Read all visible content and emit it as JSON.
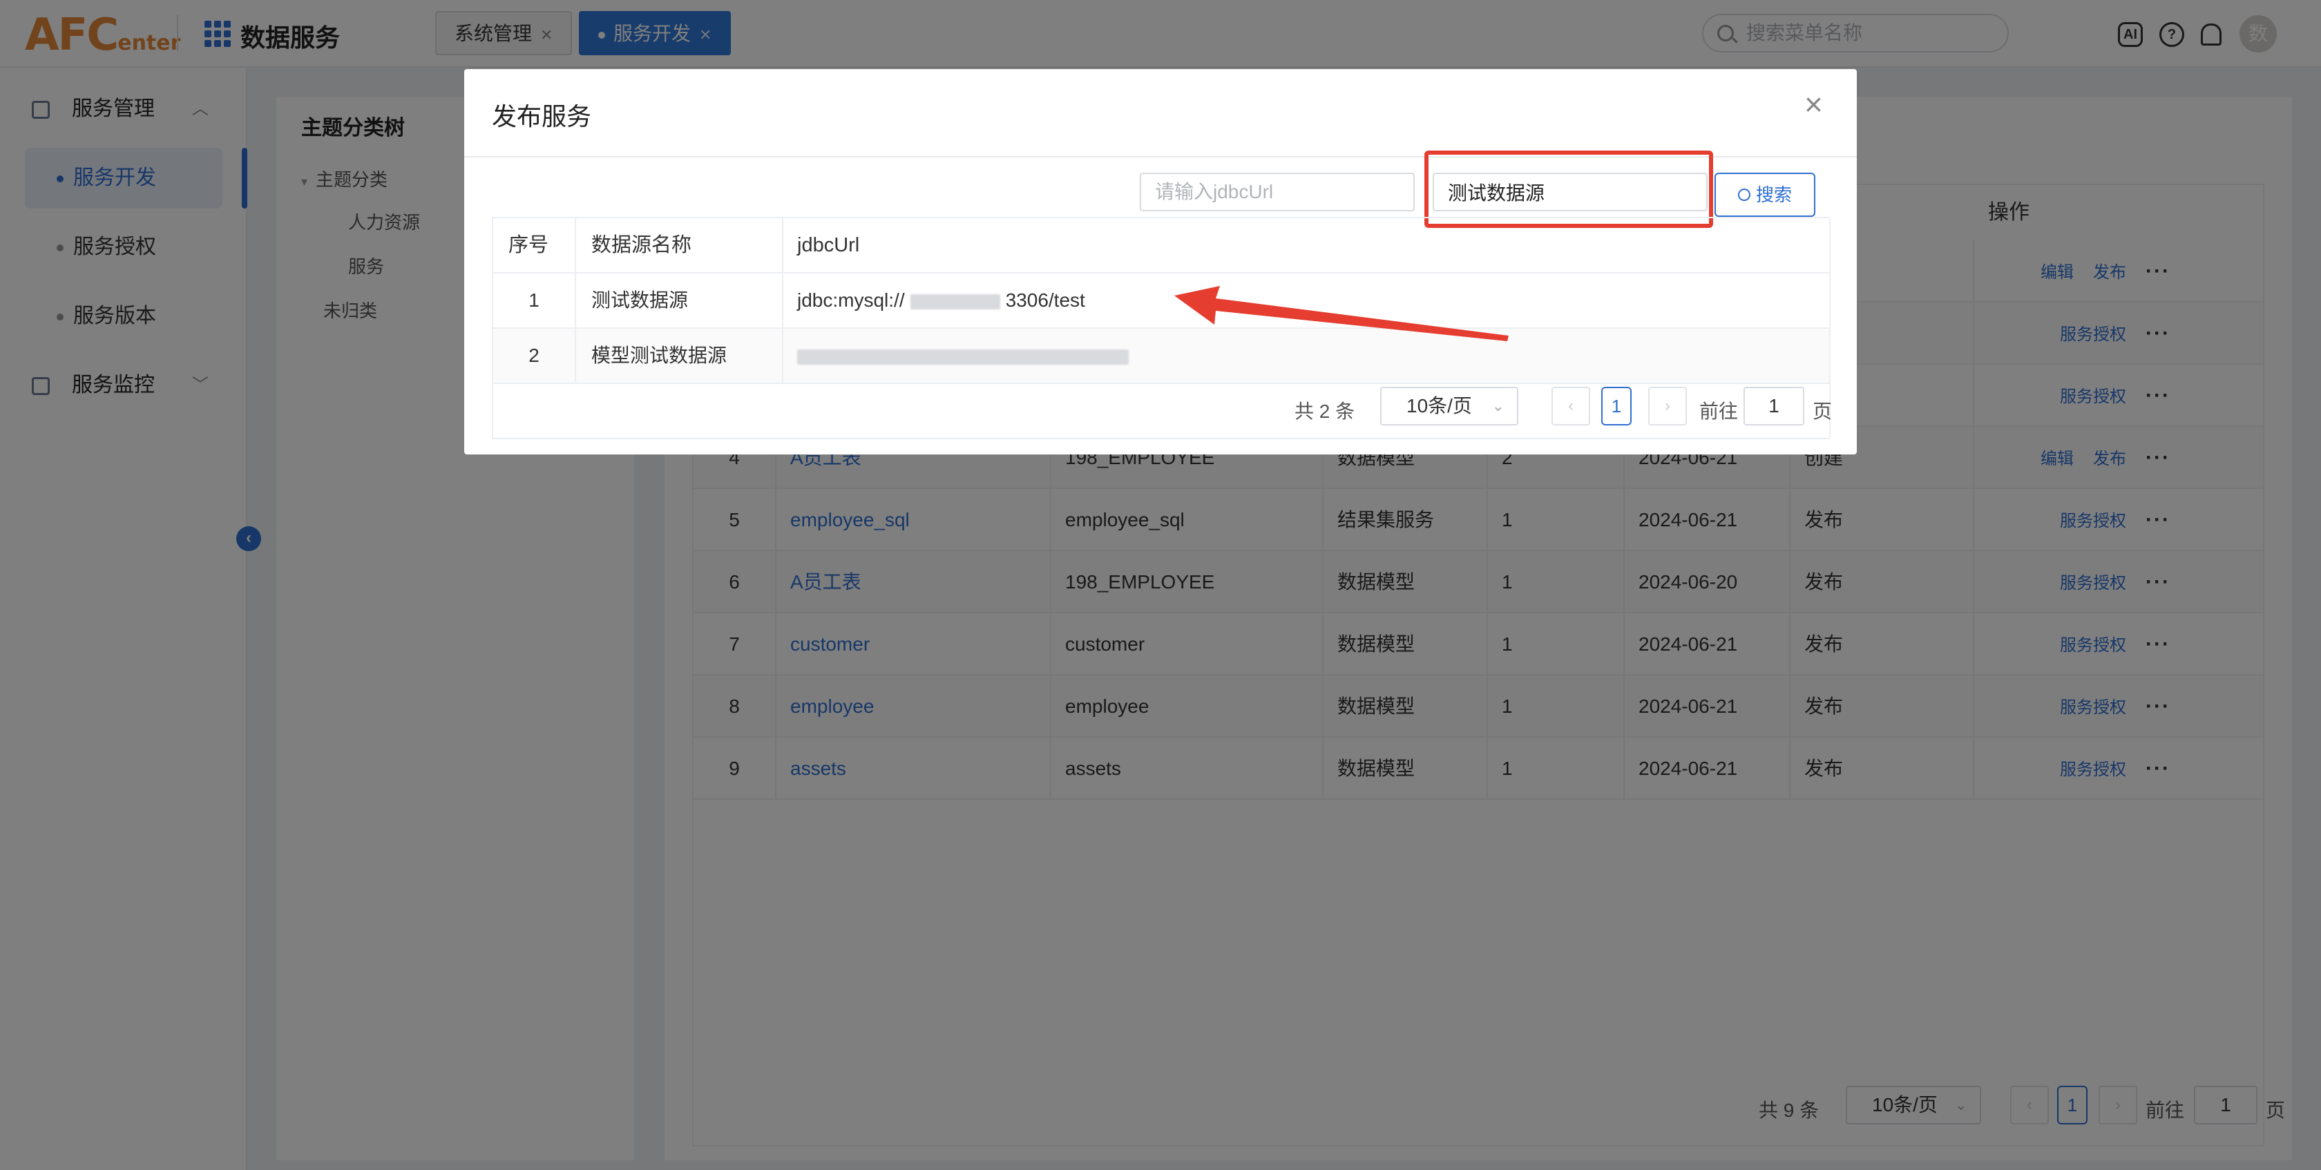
{
  "app": {
    "logo_main": "AFC",
    "logo_sub": "enter",
    "title": "数据服务",
    "tabs": [
      {
        "label": "系统管理"
      },
      {
        "label": "服务开发"
      }
    ],
    "search_placeholder": "搜索菜单名称",
    "ai_label": "AI",
    "help_label": "?",
    "avatar_text": "数"
  },
  "sidebar": {
    "group1": "服务管理",
    "items": [
      {
        "label": "服务开发"
      },
      {
        "label": "服务授权"
      },
      {
        "label": "服务版本"
      }
    ],
    "group2": "服务监控",
    "collapse_glyph": "‹"
  },
  "tree": {
    "title": "主题分类树",
    "root": "主题分类",
    "children": [
      "人力资源",
      "服务"
    ],
    "uncategorized": "未归类"
  },
  "service_table": {
    "ops_header": "操作",
    "rows": [
      {
        "no": "",
        "name": "",
        "table": "",
        "type": "",
        "version": "",
        "date": "",
        "status": "",
        "ops": [
          "编辑",
          "发布"
        ]
      },
      {
        "no": "",
        "name": "",
        "table": "",
        "type": "",
        "version": "",
        "date": "",
        "status": "",
        "ops": [
          "服务授权"
        ]
      },
      {
        "no": "",
        "name": "",
        "table": "",
        "type": "",
        "version": "",
        "date": "",
        "status": "",
        "ops": [
          "服务授权"
        ]
      },
      {
        "no": "4",
        "name": "A员工表",
        "table": "198_EMPLOYEE",
        "type": "数据模型",
        "version": "2",
        "date": "2024-06-21",
        "status": "创建",
        "ops": [
          "编辑",
          "发布"
        ]
      },
      {
        "no": "5",
        "name": "employee_sql",
        "table": "employee_sql",
        "type": "结果集服务",
        "version": "1",
        "date": "2024-06-21",
        "status": "发布",
        "ops": [
          "服务授权"
        ]
      },
      {
        "no": "6",
        "name": "A员工表",
        "table": "198_EMPLOYEE",
        "type": "数据模型",
        "version": "1",
        "date": "2024-06-20",
        "status": "发布",
        "ops": [
          "服务授权"
        ]
      },
      {
        "no": "7",
        "name": "customer",
        "table": "customer",
        "type": "数据模型",
        "version": "1",
        "date": "2024-06-21",
        "status": "发布",
        "ops": [
          "服务授权"
        ]
      },
      {
        "no": "8",
        "name": "employee",
        "table": "employee",
        "type": "数据模型",
        "version": "1",
        "date": "2024-06-21",
        "status": "发布",
        "ops": [
          "服务授权"
        ]
      },
      {
        "no": "9",
        "name": "assets",
        "table": "assets",
        "type": "数据模型",
        "version": "1",
        "date": "2024-06-21",
        "status": "发布",
        "ops": [
          "服务授权"
        ]
      }
    ],
    "more_glyph": "···",
    "pager": {
      "total": "共 9 条",
      "page_size": "10条/页",
      "current_page": "1",
      "goto_label": "前往",
      "goto_value": "1",
      "page_unit": "页"
    }
  },
  "dialog": {
    "title": "发布服务",
    "close_glyph": "×",
    "jdbc_placeholder": "请输入jdbcUrl",
    "name_value": "测试数据源",
    "search_label": "搜索",
    "columns": [
      "序号",
      "数据源名称",
      "jdbcUrl"
    ],
    "rows": [
      {
        "no": "1",
        "name": "测试数据源",
        "url_prefix": "jdbc:mysql://",
        "url_suffix": "3306/test"
      },
      {
        "no": "2",
        "name": "模型测试数据源",
        "url_prefix": "",
        "url_suffix": ""
      }
    ],
    "pager": {
      "total": "共 2 条",
      "page_size": "10条/页",
      "current_page": "1",
      "goto_label": "前往",
      "goto_value": "1",
      "page_unit": "页"
    },
    "highlight_color": "#e53d2f"
  },
  "colors": {
    "accent": "#2f6fd1",
    "logo": "#e4893a",
    "annotation": "#e53d2f"
  }
}
